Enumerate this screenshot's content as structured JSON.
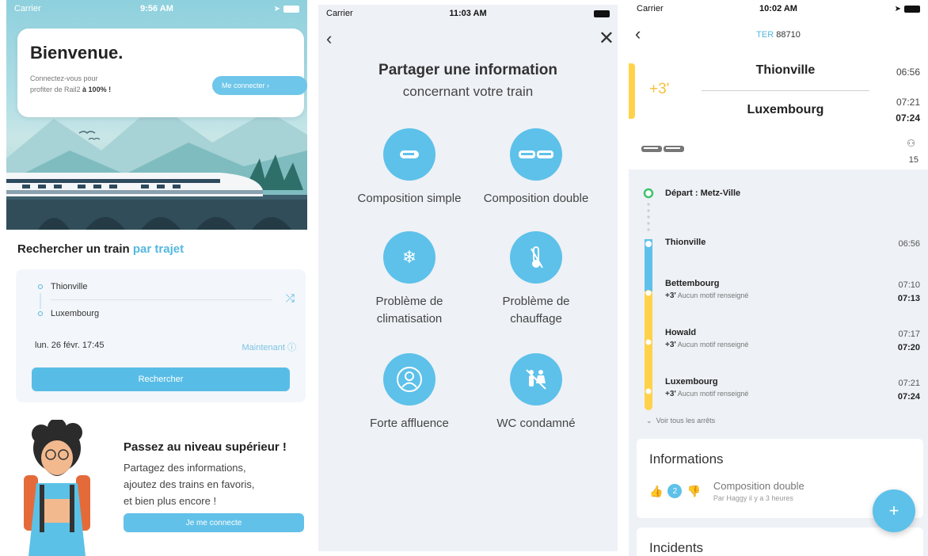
{
  "screen1": {
    "status": {
      "carrier": "Carrier",
      "time": "9:56 AM"
    },
    "welcome": {
      "title": "Bienvenue.",
      "text_line1": "Connectez-vous pour",
      "text_line2_prefix": "profiter de Rail2 ",
      "text_line2_bold": "à 100% !",
      "connect_label": "Me connecter ›"
    },
    "search": {
      "title_prefix": "Rechercher un train ",
      "title_accent": "par trajet",
      "from": "Thionville",
      "to": "Luxembourg",
      "date": "lun. 26 févr. 17:45",
      "now_label": "Maintenant ⓘ",
      "button_label": "Rechercher"
    },
    "promo": {
      "title": "Passez au niveau supérieur !",
      "line1": "Partagez des informations,",
      "line2": "ajoutez des trains en favoris,",
      "line3": "et bien plus encore !",
      "button_label": "Je me connecte"
    },
    "colors": {
      "accent": "#55b8e0",
      "button": "#58bde6"
    }
  },
  "screen2": {
    "status": {
      "carrier": "Carrier",
      "time": "11:03 AM"
    },
    "title": "Partager une information",
    "subtitle": "concernant votre train",
    "options": [
      {
        "label": "Composition simple",
        "icon": "train-single-icon"
      },
      {
        "label": "Composition double",
        "icon": "train-double-icon"
      },
      {
        "label_line1": "Problème de",
        "label_line2": "climatisation",
        "icon": "snowflake-icon"
      },
      {
        "label_line1": "Problème de",
        "label_line2": "chauffage",
        "icon": "thermometer-icon"
      },
      {
        "label": "Forte affluence",
        "icon": "crowd-icon"
      },
      {
        "label": "WC condamné",
        "icon": "wc-icon"
      }
    ]
  },
  "screen3": {
    "status": {
      "carrier": "Carrier",
      "time": "10:02 AM"
    },
    "train": {
      "type": "TER",
      "number": "88710"
    },
    "delay": "+3'",
    "from": {
      "name": "Thionville",
      "time": "06:56"
    },
    "to": {
      "name": "Luxembourg",
      "time_planned": "07:21",
      "time_actual": "07:24"
    },
    "seats": "15",
    "departure_label": "Départ : Metz-Ville",
    "stops": [
      {
        "name": "Thionville",
        "time": "06:56"
      },
      {
        "name": "Bettembourg",
        "delay": "+3'",
        "reason": "Aucun motif renseigné",
        "time_planned": "07:10",
        "time_actual": "07:13"
      },
      {
        "name": "Howald",
        "delay": "+3'",
        "reason": "Aucun motif renseigné",
        "time_planned": "07:17",
        "time_actual": "07:20"
      },
      {
        "name": "Luxembourg",
        "delay": "+3'",
        "reason": "Aucun motif renseigné",
        "time_planned": "07:21",
        "time_actual": "07:24"
      }
    ],
    "see_all": "Voir tous les arrêts",
    "informations": {
      "title": "Informations",
      "vote_count": "2",
      "item_title": "Composition double",
      "item_meta": "Par Haggy il y a 3 heures"
    },
    "incidents_title": "Incidents",
    "fab_label": "+",
    "colors": {
      "delay": "#ffd24a",
      "rail": "#5dc1ea",
      "green": "#3cc46b",
      "red": "#e8483d"
    }
  }
}
